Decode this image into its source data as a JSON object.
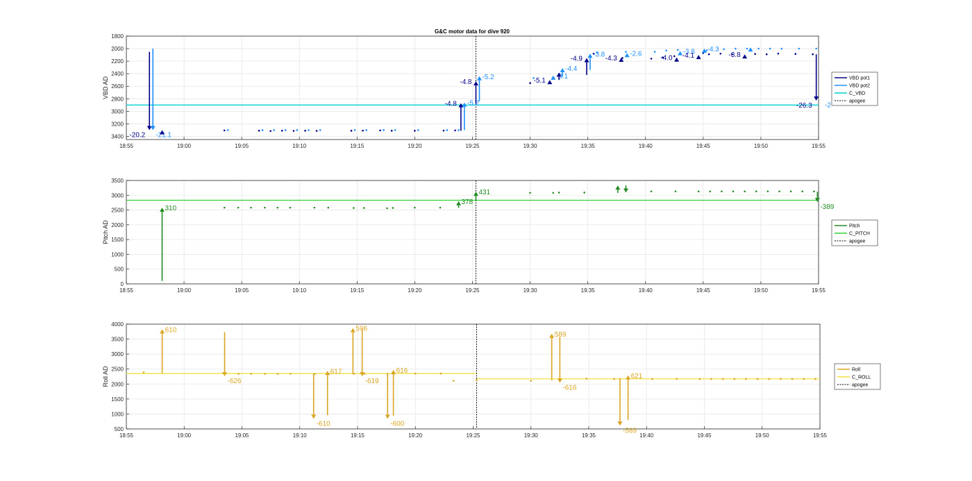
{
  "figure_title": "G&C motor data for dive 920",
  "chart_data": [
    {
      "id": "vbd",
      "type": "scatter",
      "title": "G&C motor data for dive 920",
      "ylabel": "VBD AD",
      "y_reversed": true,
      "ylim": [
        1800,
        3450
      ],
      "yticks": [
        1800,
        2000,
        2200,
        2400,
        2600,
        2800,
        3000,
        3200,
        3400
      ],
      "xlim": [
        0,
        60
      ],
      "xticks": [
        0,
        5,
        10,
        15,
        20,
        25,
        30,
        35,
        40,
        45,
        50,
        55,
        60
      ],
      "xticklabels": [
        "18:55",
        "19:00",
        "19:05",
        "19:10",
        "19:15",
        "19:20",
        "19:25",
        "19:30",
        "19:35",
        "19:40",
        "19:45",
        "19:50",
        "19:55"
      ],
      "grid": true,
      "legend_position": "right",
      "legend": [
        {
          "label": "VBD pot1",
          "color": "#00008b",
          "style": "solid"
        },
        {
          "label": "VBD pot2",
          "color": "#1e90ff",
          "style": "solid"
        },
        {
          "label": "C_VBD",
          "color": "#00ced1",
          "style": "solid"
        },
        {
          "label": "apogee",
          "color": "#000000",
          "style": "dotted"
        }
      ],
      "reference_lines": [
        {
          "name": "C_VBD",
          "y": 2900,
          "color": "#00ced1"
        }
      ],
      "apogee_x": 30.3,
      "series": [
        {
          "name": "VBD pot1",
          "color": "#00008b",
          "points": [
            [
              8.5,
              3305
            ],
            [
              11.5,
              3310
            ],
            [
              12.5,
              3315
            ],
            [
              13.5,
              3310
            ],
            [
              14.5,
              3312
            ],
            [
              15.5,
              3310
            ],
            [
              16.5,
              3312
            ],
            [
              19.5,
              3310
            ],
            [
              20.5,
              3308
            ],
            [
              22,
              3305
            ],
            [
              23,
              3310
            ],
            [
              25,
              3310
            ],
            [
              27.5,
              3308
            ],
            [
              28.5,
              3305
            ],
            [
              35,
              2550
            ],
            [
              40.5,
              2080
            ],
            [
              43,
              2150
            ],
            [
              45.5,
              2160
            ],
            [
              46.5,
              2140
            ],
            [
              47.5,
              2120
            ],
            [
              50,
              2070
            ],
            [
              50.5,
              2090
            ],
            [
              51.5,
              2080
            ],
            [
              52.5,
              2090
            ],
            [
              54.5,
              2085
            ],
            [
              55.5,
              2090
            ],
            [
              56.5,
              2080
            ],
            [
              58,
              2085
            ],
            [
              59.5,
              2090
            ]
          ]
        },
        {
          "name": "VBD pot2",
          "color": "#1e90ff",
          "points": [
            [
              8.8,
              3300
            ],
            [
              11.8,
              3300
            ],
            [
              12.8,
              3300
            ],
            [
              13.8,
              3300
            ],
            [
              14.8,
              3300
            ],
            [
              15.8,
              3300
            ],
            [
              16.8,
              3300
            ],
            [
              19.8,
              3300
            ],
            [
              20.8,
              3300
            ],
            [
              22.3,
              3300
            ],
            [
              23.3,
              3300
            ],
            [
              25.3,
              3300
            ],
            [
              27.8,
              3300
            ],
            [
              28.8,
              3300
            ],
            [
              35.3,
              2470
            ],
            [
              40.8,
              2060
            ],
            [
              43.3,
              2050
            ],
            [
              45.8,
              2050
            ],
            [
              46.8,
              2030
            ],
            [
              47.8,
              2020
            ],
            [
              50.3,
              2030
            ],
            [
              51.8,
              2010
            ],
            [
              52.8,
              2000
            ],
            [
              53.8,
              2000
            ],
            [
              54.8,
              2000
            ],
            [
              55.8,
              2000
            ],
            [
              56.8,
              2000
            ],
            [
              58.3,
              2000
            ],
            [
              59.8,
              2000
            ]
          ]
        }
      ],
      "moves": [
        {
          "series": "VBD pot1",
          "x": 2,
          "from": 2050,
          "to": 3300,
          "label": "-20.2"
        },
        {
          "series": "VBD pot2",
          "x": 2.3,
          "from": 2000,
          "to": 3300,
          "label": "-21.1"
        },
        {
          "series": "VBD pot1",
          "x": 3.1,
          "from": 3310,
          "to": 3300,
          "label": ""
        },
        {
          "series": "VBD pot1",
          "x": 29,
          "from": 3310,
          "to": 2870,
          "label": "-4.8"
        },
        {
          "series": "VBD pot2",
          "x": 29.3,
          "from": 3300,
          "to": 2860,
          "label": "-5.2"
        },
        {
          "series": "VBD pot1",
          "x": 30.3,
          "from": 2880,
          "to": 2520,
          "label": "-4.8"
        },
        {
          "series": "VBD pot2",
          "x": 30.6,
          "from": 2840,
          "to": 2440,
          "label": "-5.2"
        },
        {
          "series": "VBD pot1",
          "x": 36.7,
          "from": 2530,
          "to": 2500,
          "label": "-5.1"
        },
        {
          "series": "VBD pot2",
          "x": 37,
          "from": 2470,
          "to": 2430,
          "label": "-3.1"
        },
        {
          "series": "VBD pot1",
          "x": 37.5,
          "from": 2500,
          "to": 2380,
          "label": ""
        },
        {
          "series": "VBD pot2",
          "x": 37.8,
          "from": 2450,
          "to": 2310,
          "label": "-4.4"
        },
        {
          "series": "VBD pot1",
          "x": 39.9,
          "from": 2420,
          "to": 2150,
          "label": "-4.9"
        },
        {
          "series": "VBD pot2",
          "x": 40.2,
          "from": 2340,
          "to": 2080,
          "label": "-3.8"
        },
        {
          "series": "VBD pot1",
          "x": 42.9,
          "from": 2175,
          "to": 2145,
          "label": "-4.3"
        },
        {
          "series": "VBD pot2",
          "x": 43.4,
          "from": 2110,
          "to": 2070,
          "label": "-2.6"
        },
        {
          "series": "VBD pot1",
          "x": 47.7,
          "from": 2175,
          "to": 2140,
          "label": "-4.0"
        },
        {
          "series": "VBD pot2",
          "x": 48,
          "from": 2080,
          "to": 2040,
          "label": "-3.8"
        },
        {
          "series": "VBD pot1",
          "x": 49.6,
          "from": 2140,
          "to": 2100,
          "label": "-4.1"
        },
        {
          "series": "VBD pot2",
          "x": 50.1,
          "from": 2040,
          "to": 2000,
          "label": "-4.3"
        },
        {
          "series": "VBD pot1",
          "x": 53.6,
          "from": 2120,
          "to": 2090,
          "label": "-3.8"
        },
        {
          "series": "VBD pot2",
          "x": 54.1,
          "from": 2020,
          "to": 1980,
          "label": ""
        },
        {
          "series": "VBD pot1",
          "x": 59.8,
          "from": 2090,
          "to": 2830,
          "label": "-26.3"
        }
      ],
      "clipped_label": "-2"
    },
    {
      "id": "pitch",
      "type": "scatter",
      "ylabel": "Pitch AD",
      "ylim": [
        0,
        3500
      ],
      "yticks": [
        0,
        500,
        1000,
        1500,
        2000,
        2500,
        3000,
        3500
      ],
      "xlim": [
        0,
        60
      ],
      "xticks": [
        0,
        5,
        10,
        15,
        20,
        25,
        30,
        35,
        40,
        45,
        50,
        55,
        60
      ],
      "xticklabels": [
        "18:55",
        "19:00",
        "19:05",
        "19:10",
        "19:15",
        "19:20",
        "19:25",
        "19:30",
        "19:35",
        "19:40",
        "19:45",
        "19:50",
        "19:55"
      ],
      "grid": true,
      "legend_position": "right",
      "legend": [
        {
          "label": "Pitch",
          "color": "#228b22",
          "style": "solid"
        },
        {
          "label": "C_PITCH",
          "color": "#32cd32",
          "style": "solid"
        },
        {
          "label": "apogee",
          "color": "#000000",
          "style": "dotted"
        }
      ],
      "reference_lines": [
        {
          "name": "C_PITCH",
          "y": 2830,
          "color": "#32cd32"
        }
      ],
      "apogee_x": 30.3,
      "series": [
        {
          "name": "Pitch",
          "color": "#228b22",
          "points": [
            [
              8.5,
              2580
            ],
            [
              9.7,
              2580
            ],
            [
              10.8,
              2580
            ],
            [
              12,
              2580
            ],
            [
              13.1,
              2580
            ],
            [
              14.2,
              2580
            ],
            [
              16.3,
              2580
            ],
            [
              17.5,
              2580
            ],
            [
              19.7,
              2570
            ],
            [
              20.6,
              2570
            ],
            [
              22.6,
              2560
            ],
            [
              23.1,
              2570
            ],
            [
              25,
              2580
            ],
            [
              27.2,
              2580
            ],
            [
              35,
              3080
            ],
            [
              37,
              3080
            ],
            [
              37.5,
              3090
            ],
            [
              39.7,
              3090
            ],
            [
              45.5,
              3130
            ],
            [
              47.6,
              3130
            ],
            [
              49.6,
              3130
            ],
            [
              50.6,
              3130
            ],
            [
              51.6,
              3130
            ],
            [
              52.6,
              3130
            ],
            [
              53.6,
              3130
            ],
            [
              54.6,
              3130
            ],
            [
              55.6,
              3130
            ],
            [
              56.6,
              3130
            ],
            [
              57.6,
              3130
            ],
            [
              58.6,
              3130
            ],
            [
              59.6,
              3130
            ]
          ]
        }
      ],
      "moves": [
        {
          "series": "Pitch",
          "x": 3.1,
          "from": 100,
          "to": 2580,
          "label": "310"
        },
        {
          "series": "Pitch",
          "x": 28.8,
          "from": 2570,
          "to": 2800,
          "label": "378"
        },
        {
          "series": "Pitch",
          "x": 30.3,
          "from": 2800,
          "to": 3120,
          "label": "431"
        },
        {
          "series": "Pitch",
          "x": 42.6,
          "from": 3080,
          "to": 3330,
          "label": ""
        },
        {
          "series": "Pitch",
          "x": 43.3,
          "from": 3330,
          "to": 3090,
          "label": ""
        },
        {
          "series": "Pitch",
          "x": 59.9,
          "from": 3120,
          "to": 2770,
          "label": "-389"
        }
      ]
    },
    {
      "id": "roll",
      "type": "scatter",
      "ylabel": "Roll AD",
      "ylim": [
        500,
        4000
      ],
      "yticks": [
        500,
        1000,
        1500,
        2000,
        2500,
        3000,
        3500,
        4000
      ],
      "xlim": [
        0,
        60
      ],
      "xticks": [
        0,
        5,
        10,
        15,
        20,
        25,
        30,
        35,
        40,
        45,
        50,
        55,
        60
      ],
      "xticklabels": [
        "18:55",
        "19:00",
        "19:05",
        "19:10",
        "19:15",
        "19:20",
        "19:25",
        "19:30",
        "19:35",
        "19:40",
        "19:45",
        "19:50",
        "19:55"
      ],
      "grid": true,
      "legend_position": "right",
      "legend": [
        {
          "label": "Roll",
          "color": "#daa520",
          "style": "solid"
        },
        {
          "label": "C_ROLL",
          "color": "#f0e040",
          "style": "solid"
        },
        {
          "label": "apogee",
          "color": "#000000",
          "style": "dotted"
        }
      ],
      "reference_lines": [
        {
          "name": "C_ROLL",
          "x_from": 0,
          "x_to": 30.3,
          "y": 2350,
          "color": "#f0e040"
        },
        {
          "name": "C_ROLL",
          "x_from": 30.3,
          "x_to": 60,
          "y": 2175,
          "color": "#f0e040"
        }
      ],
      "apogee_x": 30.3,
      "series": [
        {
          "name": "Roll",
          "color": "#daa520",
          "points": [
            [
              1.5,
              2390
            ],
            [
              9.7,
              2340
            ],
            [
              10.8,
              2340
            ],
            [
              12,
              2340
            ],
            [
              13.1,
              2340
            ],
            [
              14.2,
              2340
            ],
            [
              16.3,
              2340
            ],
            [
              17.5,
              2340
            ],
            [
              19.7,
              2340
            ],
            [
              20.6,
              2340
            ],
            [
              22.6,
              2340
            ],
            [
              23.1,
              2340
            ],
            [
              25,
              2350
            ],
            [
              27.2,
              2350
            ],
            [
              28.3,
              2110
            ],
            [
              30.3,
              2130
            ],
            [
              35,
              2110
            ],
            [
              39.8,
              2180
            ],
            [
              42.2,
              2170
            ],
            [
              45.5,
              2170
            ],
            [
              47.6,
              2170
            ],
            [
              49.6,
              2170
            ],
            [
              50.6,
              2170
            ],
            [
              51.6,
              2170
            ],
            [
              52.6,
              2170
            ],
            [
              53.6,
              2170
            ],
            [
              54.6,
              2170
            ],
            [
              55.6,
              2170
            ],
            [
              56.6,
              2170
            ],
            [
              57.6,
              2170
            ],
            [
              58.6,
              2170
            ],
            [
              59.6,
              2170
            ]
          ]
        }
      ],
      "moves": [
        {
          "series": "Roll",
          "x": 3.1,
          "from": 2360,
          "to": 3830,
          "label": "610"
        },
        {
          "series": "Roll",
          "x": 8.5,
          "from": 3730,
          "to": 2260,
          "label": "-626"
        },
        {
          "series": "Roll",
          "x": 16.2,
          "from": 2340,
          "to": 840,
          "label": "-610"
        },
        {
          "series": "Roll",
          "x": 17.4,
          "from": 960,
          "to": 2440,
          "label": "617"
        },
        {
          "series": "Roll",
          "x": 19.6,
          "from": 2330,
          "to": 3870,
          "label": "596"
        },
        {
          "series": "Roll",
          "x": 20.4,
          "from": 3830,
          "to": 2260,
          "label": "-619"
        },
        {
          "series": "Roll",
          "x": 22.6,
          "from": 2340,
          "to": 840,
          "label": "-600"
        },
        {
          "series": "Roll",
          "x": 23.1,
          "from": 940,
          "to": 2470,
          "label": "616"
        },
        {
          "series": "Roll",
          "x": 36.8,
          "from": 2120,
          "to": 3680,
          "label": "589"
        },
        {
          "series": "Roll",
          "x": 37.5,
          "from": 3570,
          "to": 2040,
          "label": "-616"
        },
        {
          "series": "Roll",
          "x": 42.7,
          "from": 2200,
          "to": 610,
          "label": "-589"
        },
        {
          "series": "Roll",
          "x": 43.4,
          "from": 800,
          "to": 2290,
          "label": "621"
        }
      ]
    }
  ]
}
